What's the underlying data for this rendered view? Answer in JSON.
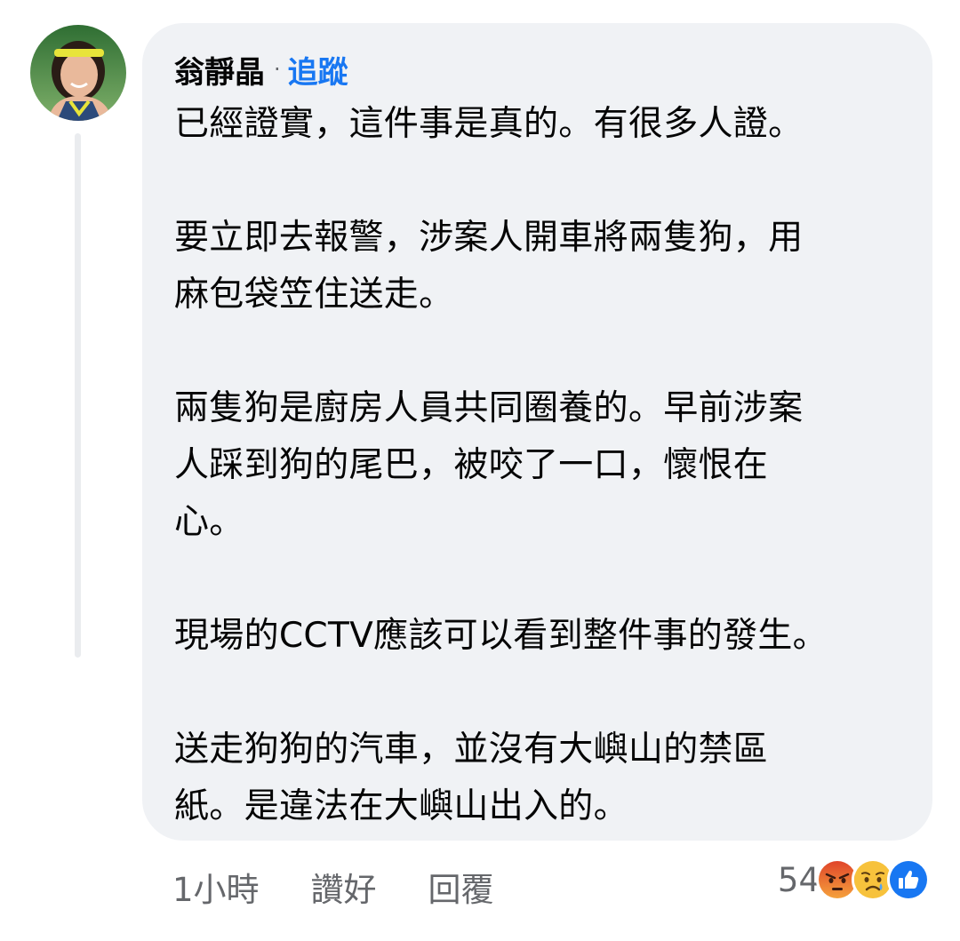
{
  "comment": {
    "author": "翁靜晶",
    "separator": "·",
    "follow_label": "追蹤",
    "paragraphs": [
      "已經證實，這件事是真的。有很多人證。",
      "要立即去報警，涉案人開車將兩隻狗，用\n麻包袋笠住送走。",
      "兩隻狗是廚房人員共同圈養的。早前涉案\n人踩到狗的尾巴，被咬了一口，懷恨在\n心。",
      "現場的CCTV應該可以看到整件事的發生。",
      "送走狗狗的汽車，並沒有大嶼山的禁區\n紙。是違法在大嶼山出入的。"
    ]
  },
  "actions": {
    "time": "1小時",
    "like_label": "讚好",
    "reply_label": "回覆"
  },
  "reactions": {
    "count": "54",
    "icons": [
      "angry-reaction-icon",
      "sad-reaction-icon",
      "like-reaction-icon"
    ]
  },
  "colors": {
    "bubble_bg": "#f0f2f5",
    "follow_link": "#1877f2",
    "secondary_text": "#65676b",
    "primary_text": "#050505",
    "like_blue": "#1877f2",
    "angry": "#f0642c",
    "sad": "#f7c23c"
  }
}
